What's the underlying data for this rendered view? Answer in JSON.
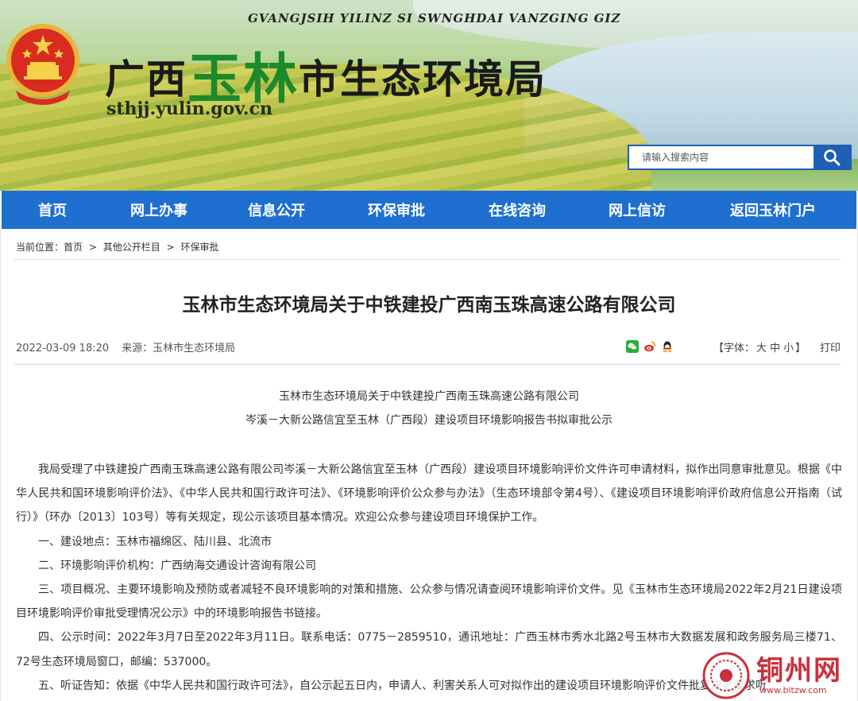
{
  "header": {
    "pinyin": "GVANGJSIH YILINZ SI SWNGHDAI VANZGING GIZ",
    "title_prefix": "广西",
    "title_city": "玉林",
    "title_suffix": "市生态环境局",
    "domain": "sthjj.yulin.gov.cn"
  },
  "search": {
    "placeholder": "请输入搜索内容"
  },
  "nav": [
    "首页",
    "网上办事",
    "信息公开",
    "环保审批",
    "在线咨询",
    "网上信访",
    "返回玉林门户"
  ],
  "breadcrumb": {
    "prefix": "当前位置：",
    "items": [
      "首页",
      "其他公开栏目",
      "环保审批"
    ],
    "sep": ">"
  },
  "article": {
    "title": "玉林市生态环境局关于中铁建投广西南玉珠高速公路有限公司",
    "date": "2022-03-09 18:20",
    "source": "来源：玉林市生态环境局",
    "font_label": "【字体：",
    "font_large": "大",
    "font_medium": "中",
    "font_small": "小",
    "font_close": "】",
    "print": "打印",
    "subtitle1": "玉林市生态环境局关于中铁建投广西南玉珠高速公路有限公司",
    "subtitle2": "岑溪－大新公路信宜至玉林（广西段）建设项目环境影响报告书拟审批公示",
    "paragraphs": [
      "我局受理了中铁建投广西南玉珠高速公路有限公司岑溪－大新公路信宜至玉林（广西段）建设项目环境影响评价文件许可申请材料，拟作出同意审批意见。根据《中华人民共和国环境影响评价法》、《中华人民共和国行政许可法》、《环境影响评价公众参与办法》（生态环境部令第4号）、《建设项目环境影响评价政府信息公开指南（试行）》（环办〔2013〕103号）等有关规定，现公示该项目基本情况。欢迎公众参与建设项目环境保护工作。",
      "一、建设地点：玉林市福绵区、陆川县、北流市",
      "二、环境影响评价机构：广西纳海交通设计咨询有限公司",
      "三、项目概况、主要环境影响及预防或者减轻不良环境影响的对策和措施、公众参与情况请查阅环境影响评价文件。见《玉林市生态环境局2022年2月21日建设项目环境影响评价审批受理情况公示》中的环境影响报告书链接。",
      "四、公示时间：2022年3月7日至2022年3月11日。联系电话：0775－2859510，通讯地址：广西玉林市秀水北路2号玉林市大数据发展和政务服务局三楼71、72号生态环境局窗口，邮编：537000。",
      "五、听证告知：依据《中华人民共和国行政许可法》，自公示起五日内，申请人、利害关系人可对拟作出的建设项目环境影响评价文件批复决定要求听"
    ]
  },
  "watermark": {
    "text": "铜州网",
    "url": "www.bitzw.com"
  },
  "colors": {
    "nav": "#1e6fd0",
    "accent": "#1f5fb5",
    "wechat": "#2aae3a",
    "weibo": "#e03a2f",
    "qq": "#2b6fd6"
  },
  "icons": [
    "national-emblem-icon",
    "search-icon",
    "wechat-icon",
    "weibo-icon",
    "qq-icon"
  ]
}
